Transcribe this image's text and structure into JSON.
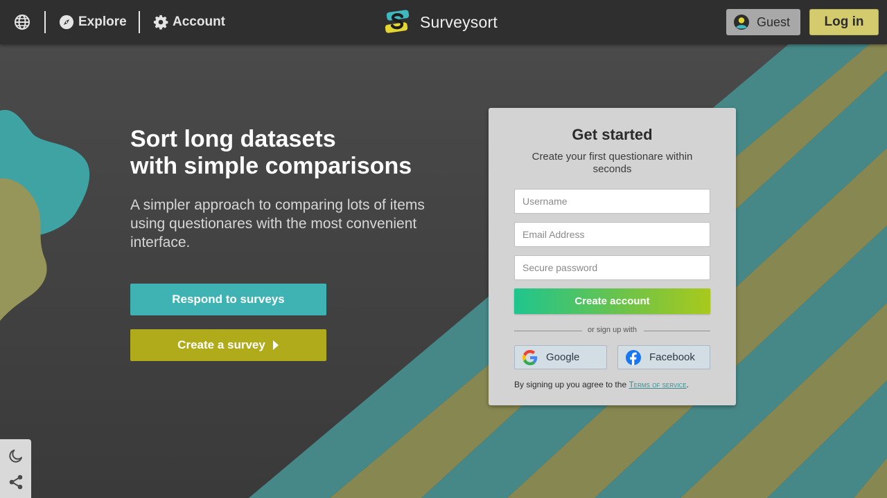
{
  "topbar": {
    "nav": [
      {
        "label": "Explore",
        "icon": "compass-icon"
      },
      {
        "label": "Account",
        "icon": "gear-icon"
      }
    ],
    "brand_name": "Surveysort",
    "guest_label": "Guest",
    "login_label": "Log in"
  },
  "hero": {
    "title_line1": "Sort long datasets",
    "title_line2": "with simple comparisons",
    "subtitle": "A simpler approach to comparing lots of items using questionares with the most convenient interface.",
    "respond_label": "Respond to surveys",
    "create_label": "Create a survey"
  },
  "signup": {
    "title": "Get started",
    "subtitle": "Create your first questionare within seconds",
    "username_placeholder": "Username",
    "email_placeholder": "Email Address",
    "password_placeholder": "Secure password",
    "submit_label": "Create account",
    "divider_text": "or sign up with",
    "google_label": "Google",
    "facebook_label": "Facebook",
    "terms_prefix": "By signing up you agree to the ",
    "terms_link": "Terms of service",
    "terms_suffix": "."
  },
  "colors": {
    "teal": "#3fb3b3",
    "olive": "#b0ab1a",
    "login_yellow": "#d3cb6e",
    "topbar": "#2f2f2f",
    "background": "#3f3f3f"
  }
}
